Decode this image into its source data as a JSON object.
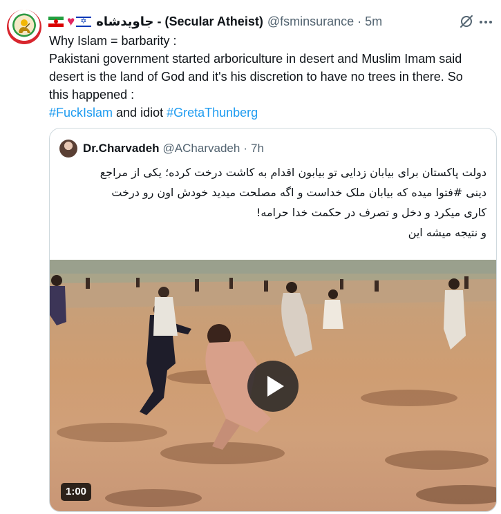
{
  "tweet": {
    "author": {
      "emoji_flags": [
        "iran-flag-icon",
        "red-heart-icon",
        "israel-flag-icon"
      ],
      "display_name": "جاویدشاه - (Secular Atheist)",
      "handle": "@fsminsurance",
      "separator": "·",
      "time": "5m"
    },
    "text_lines": [
      "Why Islam = barbarity :",
      "Pakistani government started arboriculture in desert and Muslim Imam said",
      "desert is the land of God and it's his discretion to have no trees in there. So",
      "this happened :"
    ],
    "hashtag_1": "#FuckIslam",
    "middle_text": " and idiot ",
    "hashtag_2": "#GretaThunberg",
    "icons": [
      "grok-icon",
      "more-icon"
    ]
  },
  "quote": {
    "display_name": "Dr.Charvadeh",
    "handle": "@ACharvadeh",
    "separator": "·",
    "time": "7h",
    "text_lines": [
      "دولت پاکستان برای بیابان زدایی تو بیابون اقدام به کاشت درخت کرده؛ یکی از مراجع",
      "دینی  #فتوا میده که بیابان ملک خداست و اگه مصلحت میدید خودش اون رو درخت",
      "کاری میکرد و دخل و تصرف در حکمت خدا حرامه!",
      "و نتیجه میشه این"
    ],
    "video": {
      "duration": "1:00"
    }
  }
}
